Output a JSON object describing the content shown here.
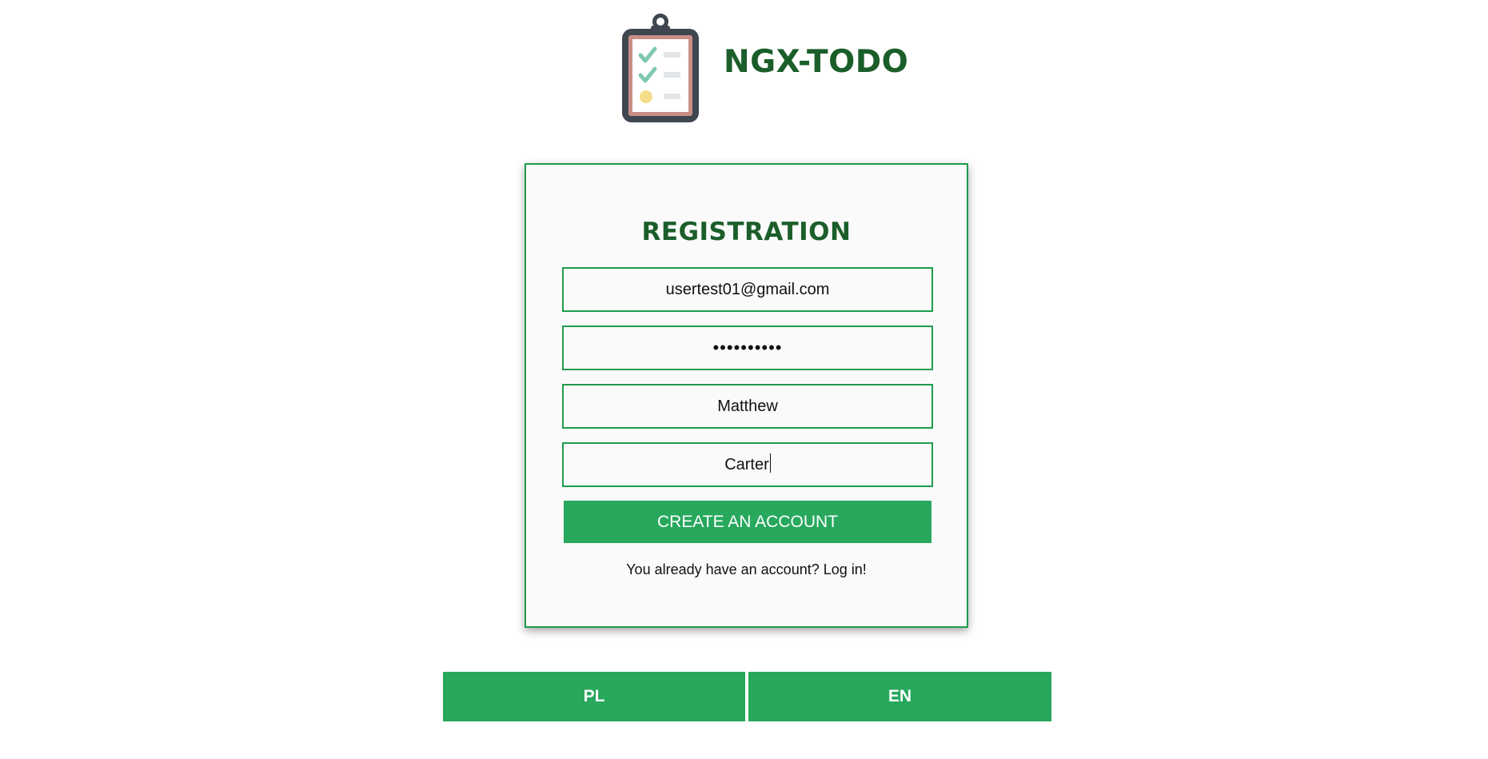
{
  "header": {
    "app_title": "NGX-TODO",
    "logo_icon": "clipboard-checklist-icon"
  },
  "registration": {
    "title": "REGISTRATION",
    "email_value": "usertest01@gmail.com",
    "password_value": "••••••••••",
    "first_name_value": "Matthew",
    "last_name_value": "Carter",
    "create_button_label": "CREATE AN ACCOUNT",
    "login_link_text": "You already have an account? Log in!"
  },
  "language": {
    "pl_label": "PL",
    "en_label": "EN"
  },
  "colors": {
    "brand_green": "#27a85d",
    "title_dark_green": "#1b5e2a",
    "border_green": "#1e9b4d"
  }
}
